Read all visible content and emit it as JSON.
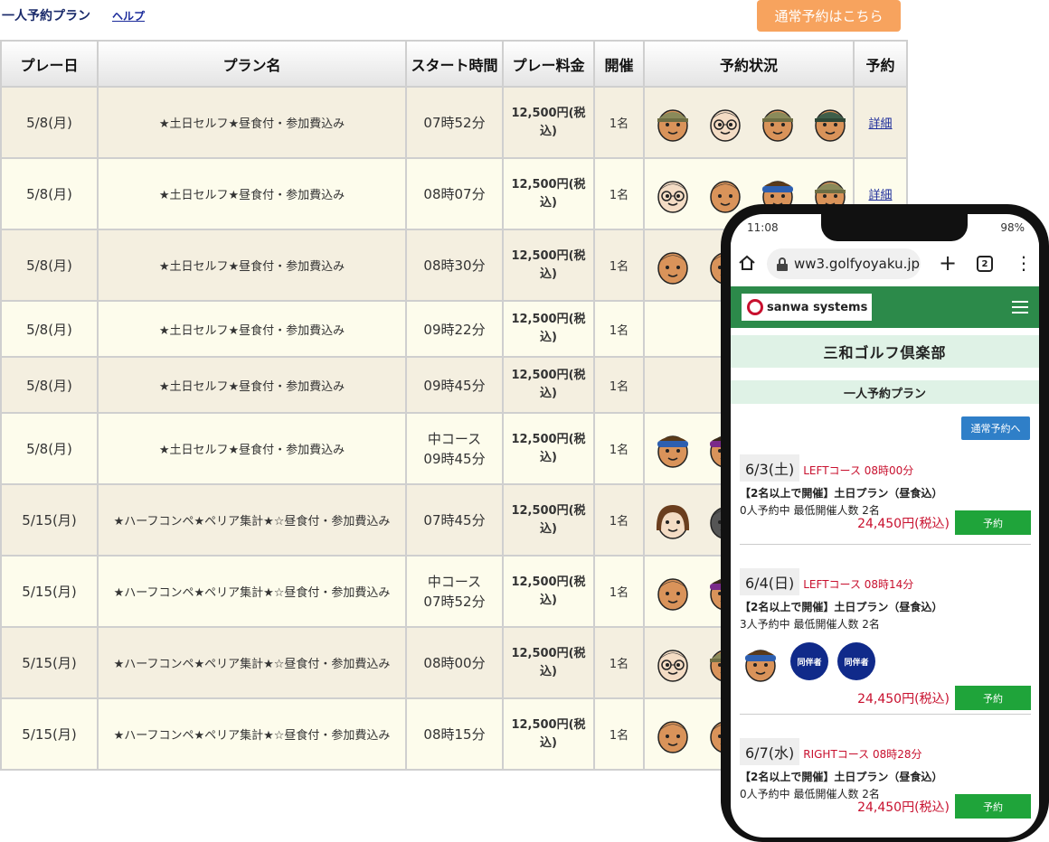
{
  "topbar": {
    "title": "一人予約プラン",
    "help": "ヘルプ",
    "normal_reservation": "通常予約はこちら"
  },
  "table": {
    "headers": [
      "プレー日",
      "プラン名",
      "スタート時間",
      "プレー料金",
      "開催",
      "予約状況",
      "予約"
    ],
    "rows": [
      {
        "date": "5/8(月)",
        "plan": "★土日セルフ★昼食付・参加費込み",
        "course": "",
        "time": "07時52分",
        "fee": "12,500円(税込)",
        "count": "1名",
        "detail": "詳細",
        "avatars": [
          "olive-cap",
          "glasses",
          "olive-cap",
          "green-cap"
        ]
      },
      {
        "date": "5/8(月)",
        "plan": "★土日セルフ★昼食付・参加費込み",
        "course": "",
        "time": "08時07分",
        "fee": "12,500円(税込)",
        "count": "1名",
        "detail": "詳細",
        "avatars": [
          "glasses",
          "plain",
          "blue-visor",
          "olive-cap"
        ]
      },
      {
        "date": "5/8(月)",
        "plan": "★土日セルフ★昼食付・参加費込み",
        "course": "",
        "time": "08時30分",
        "fee": "12,500円(税込)",
        "count": "1名",
        "detail": "",
        "avatars": [
          "plain",
          "plain"
        ]
      },
      {
        "date": "5/8(月)",
        "plan": "★土日セルフ★昼食付・参加費込み",
        "course": "",
        "time": "09時22分",
        "fee": "12,500円(税込)",
        "count": "1名",
        "detail": "",
        "avatars": []
      },
      {
        "date": "5/8(月)",
        "plan": "★土日セルフ★昼食付・参加費込み",
        "course": "",
        "time": "09時45分",
        "fee": "12,500円(税込)",
        "count": "1名",
        "detail": "",
        "avatars": []
      },
      {
        "date": "5/8(月)",
        "plan": "★土日セルフ★昼食付・参加費込み",
        "course": "中コース",
        "time": "09時45分",
        "fee": "12,500円(税込)",
        "count": "1名",
        "detail": "",
        "avatars": [
          "blue-visor",
          "purple-visor"
        ]
      },
      {
        "date": "5/15(月)",
        "plan": "★ハーフコンペ★ペリア集計★☆昼食付・参加費込み",
        "course": "",
        "time": "07時45分",
        "fee": "12,500円(税込)",
        "count": "1名",
        "detail": "",
        "avatars": [
          "woman",
          "dark"
        ]
      },
      {
        "date": "5/15(月)",
        "plan": "★ハーフコンペ★ペリア集計★☆昼食付・参加費込み",
        "course": "中コース",
        "time": "07時52分",
        "fee": "12,500円(税込)",
        "count": "1名",
        "detail": "",
        "avatars": [
          "plain",
          "purple-visor"
        ]
      },
      {
        "date": "5/15(月)",
        "plan": "★ハーフコンペ★ペリア集計★☆昼食付・参加費込み",
        "course": "",
        "time": "08時00分",
        "fee": "12,500円(税込)",
        "count": "1名",
        "detail": "",
        "avatars": [
          "glasses",
          "olive-cap"
        ]
      },
      {
        "date": "5/15(月)",
        "plan": "★ハーフコンペ★ペリア集計★☆昼食付・参加費込み",
        "course": "",
        "time": "08時15分",
        "fee": "12,500円(税込)",
        "count": "1名",
        "detail": "",
        "avatars": [
          "plain",
          "plain"
        ]
      }
    ]
  },
  "phone": {
    "clock": "11:08",
    "battery": "98%",
    "url": "ww3.golfyoyaku.jp",
    "tab_count": "2",
    "logo_text": "sanwa systems",
    "club_name": "三和ゴルフ倶楽部",
    "plan_title": "一人予約プラン",
    "normal_btn": "通常予約へ",
    "cards": [
      {
        "date": "6/3(土)",
        "course": "LEFTコース 08時00分",
        "plan": "【2名以上で開催】土日プラン（昼食込）",
        "info": "0人予約中 最低開催人数 2名",
        "price": "24,450円(税込)",
        "button": "予約",
        "companion": []
      },
      {
        "date": "6/4(日)",
        "course": "LEFTコース 08時14分",
        "plan": "【2名以上で開催】土日プラン（昼食込）",
        "info": "3人予約中 最低開催人数 2名",
        "price": "24,450円(税込)",
        "button": "予約",
        "companion": [
          "同伴者",
          "同伴者"
        ]
      },
      {
        "date": "6/7(水)",
        "course": "RIGHTコース 08時28分",
        "plan": "【2名以上で開催】土日プラン（昼食込）",
        "info": "0人予約中 最低開催人数 2名",
        "price": "24,450円(税込)",
        "button": "予約",
        "companion": []
      }
    ]
  },
  "colors": {
    "accent_orange": "#f7a35e",
    "header_green": "#2c8a4a",
    "button_green": "#1fa43a",
    "button_blue": "#2f7fc8",
    "price_red": "#c8102e",
    "row_odd": "#f4efe0",
    "row_even": "#fdfcec"
  }
}
